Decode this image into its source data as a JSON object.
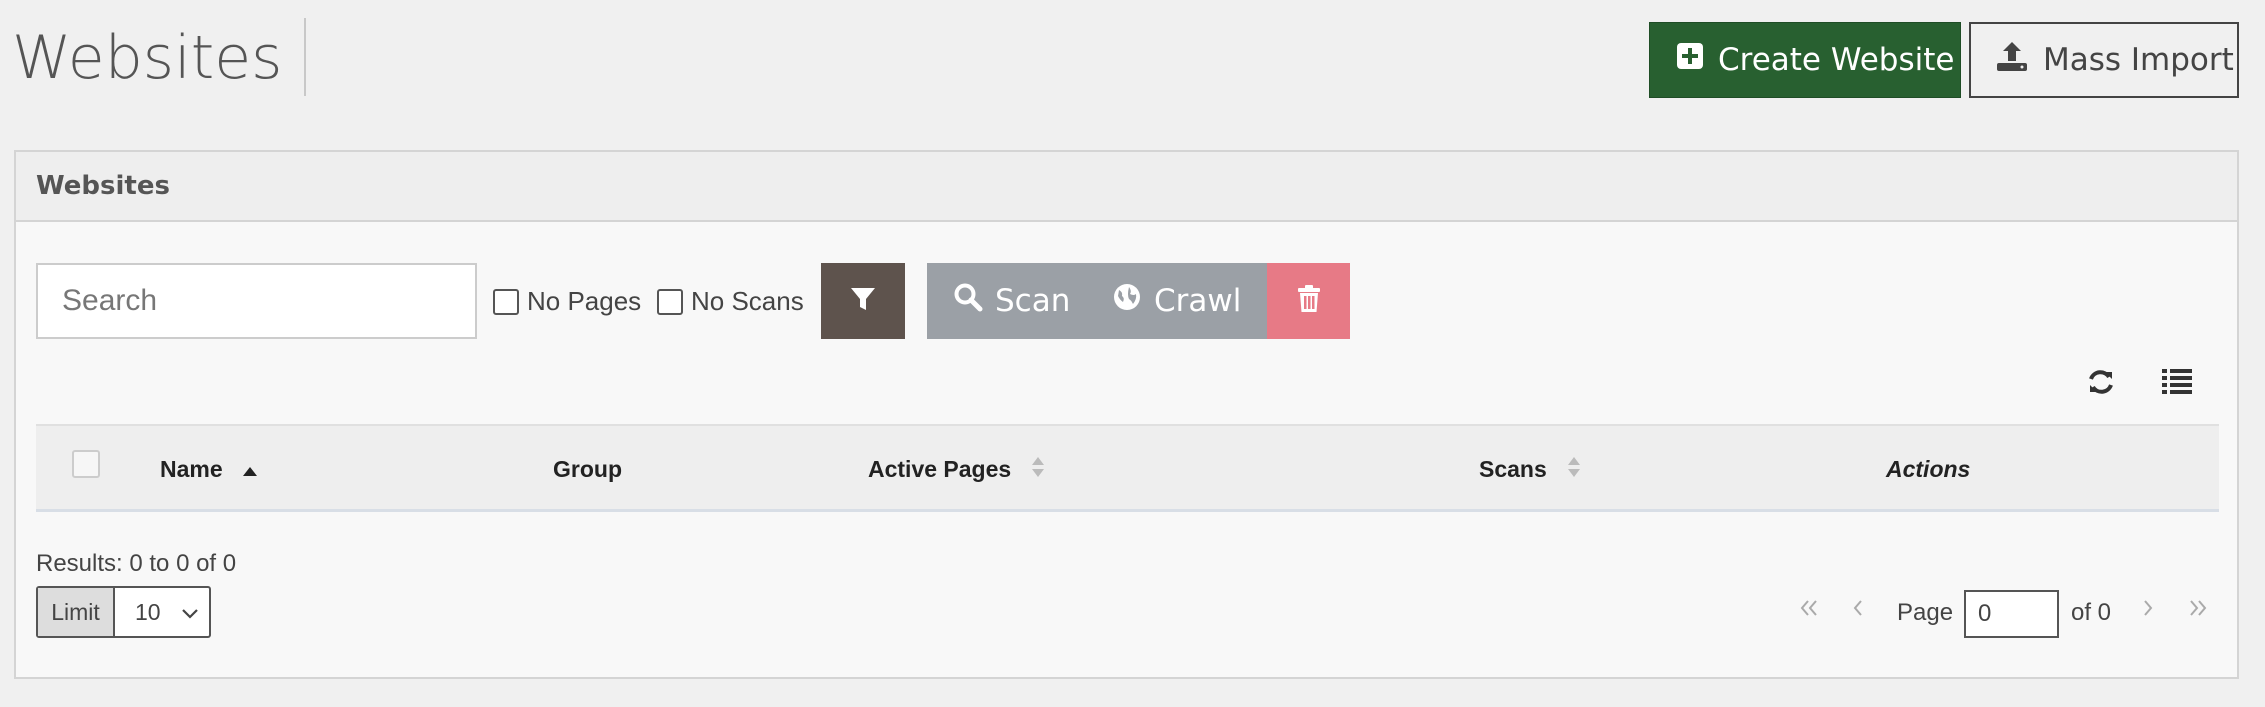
{
  "page": {
    "title": "Websites"
  },
  "header_actions": {
    "create_label": "Create Website",
    "mass_import_label": "Mass Import"
  },
  "panel": {
    "title": "Websites",
    "search": {
      "placeholder": "Search",
      "value": ""
    },
    "filters": [
      {
        "label": "No Pages",
        "checked": false
      },
      {
        "label": "No Scans",
        "checked": false
      }
    ],
    "actions": {
      "scan_label": "Scan",
      "crawl_label": "Crawl"
    },
    "colors": {
      "primary": "#286030",
      "filter": "#5e534d",
      "action_gray": "#9ba0a6",
      "delete": "#e77a86"
    }
  },
  "table": {
    "columns": [
      {
        "label": "Name",
        "sort": "ascending"
      },
      {
        "label": "Group",
        "sort": "none"
      },
      {
        "label": "Active Pages",
        "sort": "sortable"
      },
      {
        "label": "Scans",
        "sort": "sortable"
      },
      {
        "label": "Actions",
        "sort": "none"
      }
    ],
    "rows": []
  },
  "footer": {
    "results_text": "Results: 0 to 0 of 0",
    "limit_label": "Limit",
    "limit_value": "10",
    "page_label": "Page",
    "page_value": "0",
    "page_of": "of 0"
  },
  "icons": [
    "plus-square-icon",
    "upload-icon",
    "filter-icon",
    "search-icon",
    "globe-icon",
    "trash-icon",
    "refresh-icon",
    "list-icon",
    "first-page-icon",
    "prev-page-icon",
    "next-page-icon",
    "last-page-icon",
    "sort-asc-icon",
    "sort-both-icon",
    "chevron-down-icon"
  ]
}
